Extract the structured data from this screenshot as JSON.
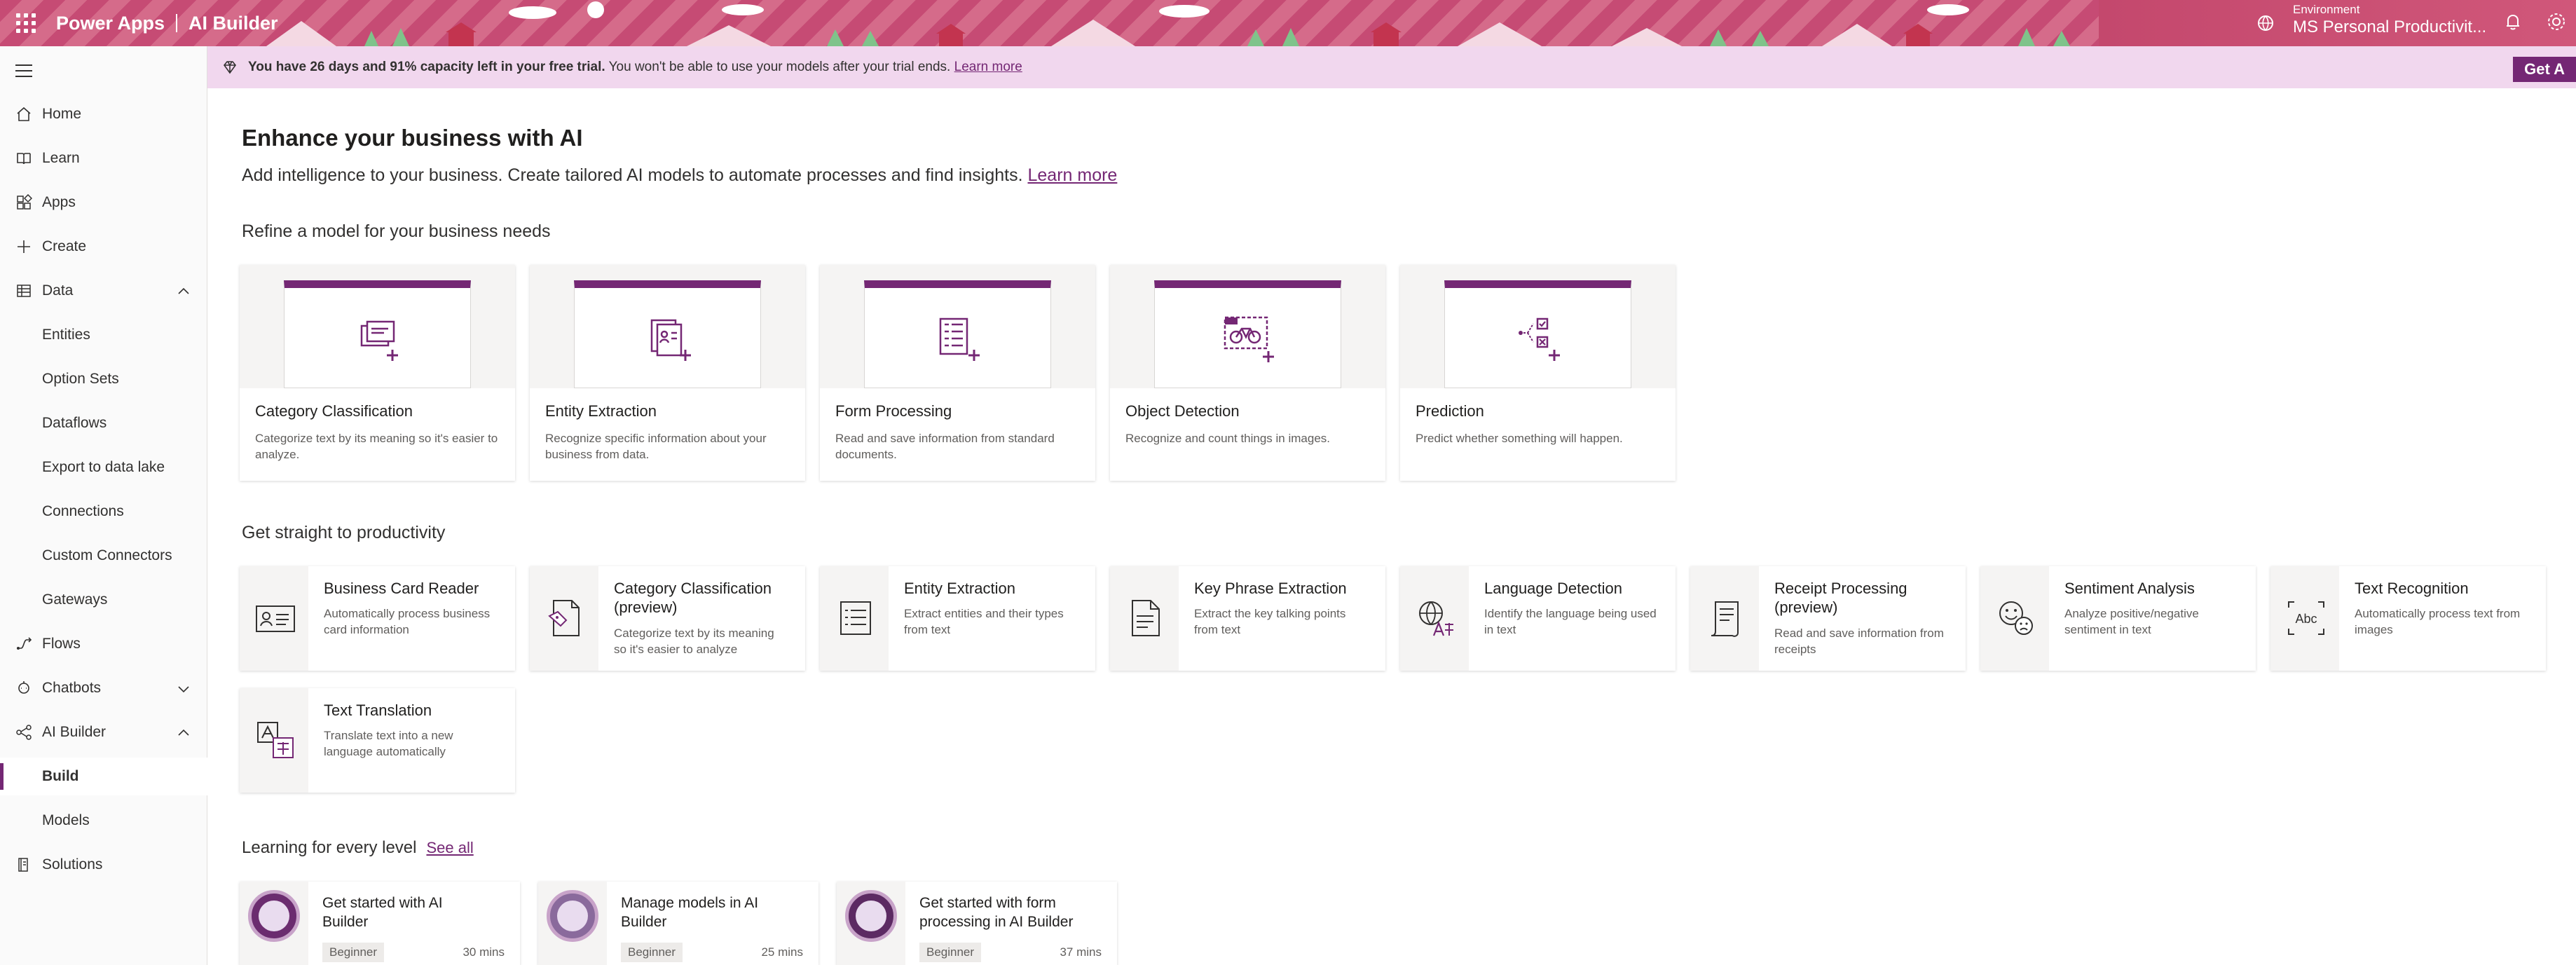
{
  "header": {
    "app_name": "Power Apps",
    "section": "AI Builder",
    "env_label": "Environment",
    "env_name": "MS Personal Productivit..."
  },
  "banner": {
    "bold": "You have 26 days and 91% capacity left in your free trial.",
    "text": " You won't be able to use your models after your trial ends. ",
    "link": "Learn more",
    "cta": "Get A"
  },
  "nav": {
    "items": [
      {
        "label": "Home",
        "icon": "home-icon"
      },
      {
        "label": "Learn",
        "icon": "book-icon"
      },
      {
        "label": "Apps",
        "icon": "apps-icon"
      },
      {
        "label": "Create",
        "icon": "plus-icon"
      },
      {
        "label": "Data",
        "icon": "table-icon"
      },
      {
        "label": "Entities"
      },
      {
        "label": "Option Sets"
      },
      {
        "label": "Dataflows"
      },
      {
        "label": "Export to data lake"
      },
      {
        "label": "Connections"
      },
      {
        "label": "Custom Connectors"
      },
      {
        "label": "Gateways"
      },
      {
        "label": "Flows",
        "icon": "flow-icon"
      },
      {
        "label": "Chatbots",
        "icon": "chatbot-icon"
      },
      {
        "label": "AI Builder",
        "icon": "ai-builder-icon"
      },
      {
        "label": "Build"
      },
      {
        "label": "Models"
      },
      {
        "label": "Solutions",
        "icon": "solutions-icon"
      }
    ]
  },
  "main": {
    "title": "Enhance your business with AI",
    "subtitle": "Add intelligence to your business. Create tailored AI models to automate processes and find insights. ",
    "subtitle_link": "Learn more",
    "refine_heading": "Refine a model for your business needs",
    "refine_cards": [
      {
        "title": "Category Classification",
        "desc": "Categorize text by its meaning so it's easier to analyze."
      },
      {
        "title": "Entity Extraction",
        "desc": "Recognize specific information about your business from data."
      },
      {
        "title": "Form Processing",
        "desc": "Read and save information from standard documents."
      },
      {
        "title": "Object Detection",
        "desc": "Recognize and count things in images."
      },
      {
        "title": "Prediction",
        "desc": "Predict whether something will happen."
      }
    ],
    "productivity_heading": "Get straight to productivity",
    "productivity_cards": [
      {
        "title": "Business Card Reader",
        "desc": "Automatically process business card information"
      },
      {
        "title": "Category Classification (preview)",
        "desc": "Categorize text by its meaning so it's easier to analyze"
      },
      {
        "title": "Entity Extraction",
        "desc": "Extract entities and their types from text"
      },
      {
        "title": "Key Phrase Extraction",
        "desc": "Extract the key talking points from text"
      },
      {
        "title": "Language Detection",
        "desc": "Identify the language being used in text"
      },
      {
        "title": "Receipt Processing (preview)",
        "desc": "Read and save information from receipts"
      },
      {
        "title": "Sentiment Analysis",
        "desc": "Analyze positive/negative sentiment in text"
      },
      {
        "title": "Text Recognition",
        "desc": "Automatically process text from images"
      },
      {
        "title": "Text Translation",
        "desc": "Translate text into a new language automatically"
      }
    ],
    "learning_heading": "Learning for every level",
    "see_all": "See all",
    "learning_cards": [
      {
        "title": "Get started with AI Builder",
        "level": "Beginner",
        "duration": "30 mins"
      },
      {
        "title": "Manage models in AI Builder",
        "level": "Beginner",
        "duration": "25 mins"
      },
      {
        "title": "Get started with form processing in AI Builder",
        "level": "Beginner",
        "duration": "37 mins"
      }
    ]
  },
  "colors": {
    "accent": "#742774",
    "banner_bg": "#f1d7ee",
    "header_bg": "#c64b74"
  }
}
